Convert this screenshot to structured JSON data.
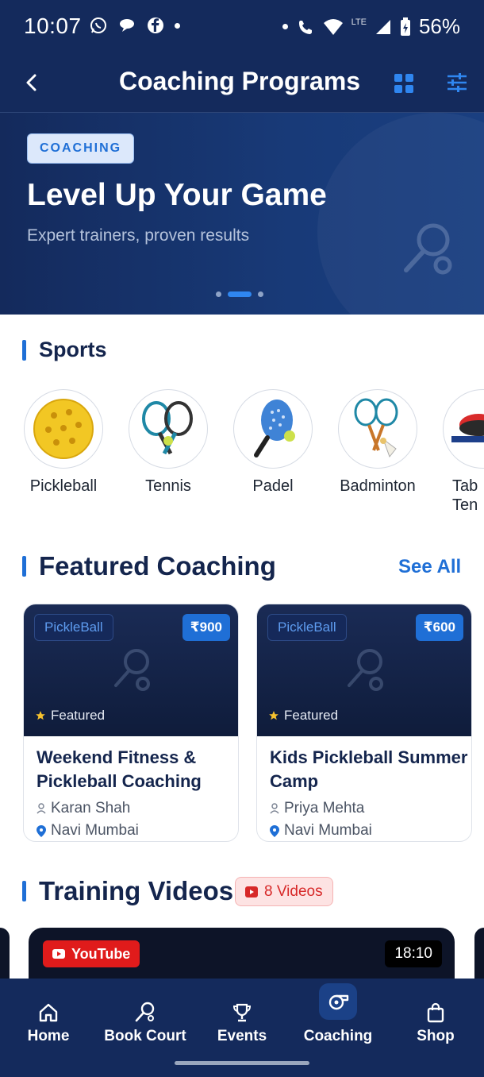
{
  "status_bar": {
    "time": "10:07",
    "battery": "56%",
    "network": "LTE"
  },
  "header": {
    "title": "Coaching Programs"
  },
  "banner": {
    "badge": "COACHING",
    "title": "Level Up Your Game",
    "subtitle": "Expert trainers, proven results",
    "active_slide": 2,
    "slide_count": 3
  },
  "sports": {
    "title": "Sports",
    "items": [
      {
        "label": "Pickleball"
      },
      {
        "label": "Tennis"
      },
      {
        "label": "Padel"
      },
      {
        "label": "Badminton"
      },
      {
        "label": "Tab\nTen"
      }
    ]
  },
  "featured": {
    "title": "Featured Coaching",
    "see_all": "See All",
    "cards": [
      {
        "tag": "PickleBall",
        "price": "₹900",
        "featured": "Featured",
        "title": "Weekend Fitness & Pickleball Coaching",
        "coach": "Karan Shah",
        "location": "Navi Mumbai"
      },
      {
        "tag": "PickleBall",
        "price": "₹600",
        "featured": "Featured",
        "title": "Kids Pickleball Summer Camp",
        "coach": "Priya Mehta",
        "location": "Navi Mumbai"
      }
    ]
  },
  "videos": {
    "title": "Training Videos",
    "count_badge": "8 Videos",
    "first": {
      "source": "YouTube",
      "duration": "18:10"
    }
  },
  "bottom_nav": {
    "items": [
      {
        "label": "Home",
        "icon": "home-icon"
      },
      {
        "label": "Book Court",
        "icon": "search-icon"
      },
      {
        "label": "Events",
        "icon": "trophy-icon"
      },
      {
        "label": "Coaching",
        "icon": "whistle-icon",
        "active": true
      },
      {
        "label": "Shop",
        "icon": "bag-icon"
      }
    ]
  },
  "colors": {
    "primary": "#1f6fd6",
    "navy": "#142a5c",
    "heading": "#14254d"
  }
}
